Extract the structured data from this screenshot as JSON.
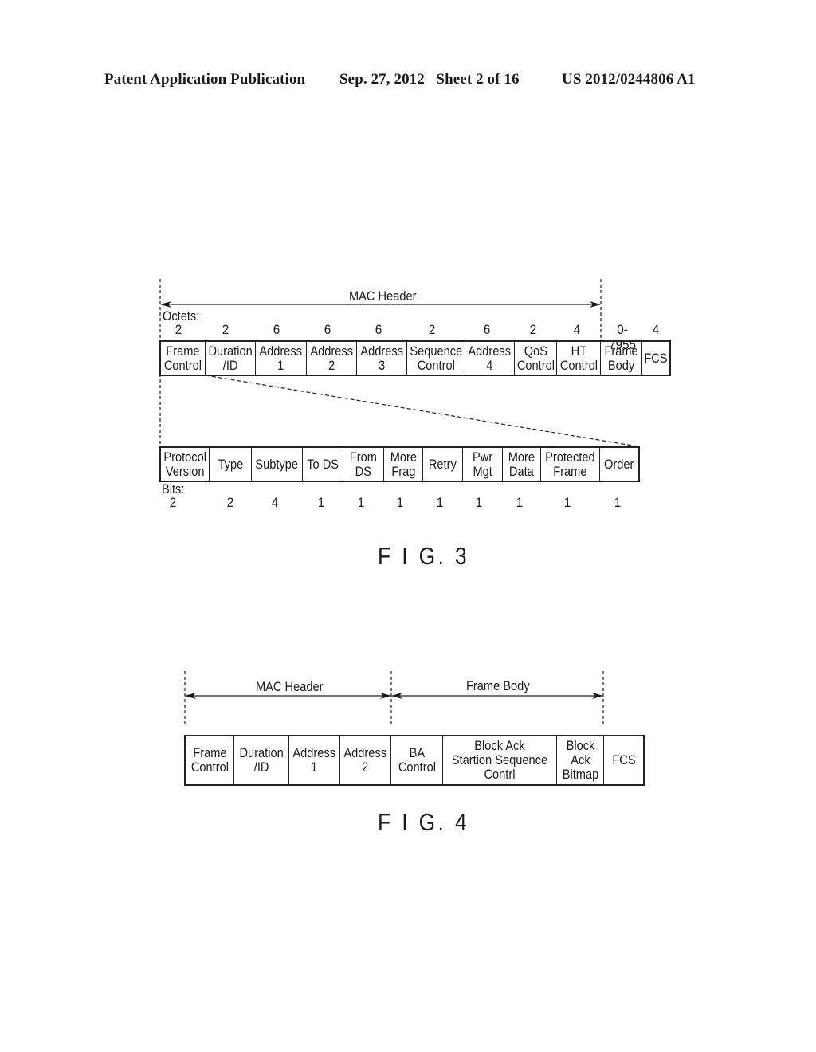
{
  "page_header": {
    "publication": "Patent Application Publication",
    "date_sheet": "Sep. 27, 2012   Sheet 2 of 16",
    "number": "US 2012/0244806 A1"
  },
  "fig3": {
    "caption": "F I G. 3",
    "mac_header_label": "MAC  Header",
    "octets_label": "Octets:",
    "frame_fields": [
      {
        "label": "Frame\nControl",
        "octets": "2"
      },
      {
        "label": "Duration\n/ID",
        "octets": "2"
      },
      {
        "label": "Address\n1",
        "octets": "6"
      },
      {
        "label": "Address\n2",
        "octets": "6"
      },
      {
        "label": "Address\n3",
        "octets": "6"
      },
      {
        "label": "Sequence\nControl",
        "octets": "2"
      },
      {
        "label": "Address\n4",
        "octets": "6"
      },
      {
        "label": "QoS\nControl",
        "octets": "2"
      },
      {
        "label": "HT\nControl",
        "octets": "4"
      },
      {
        "label": "Frame\nBody",
        "octets": "0-7955"
      },
      {
        "label": "FCS",
        "octets": "4"
      }
    ],
    "bits_label": "Bits:",
    "frame_control_fields": [
      {
        "label": "Protocol\nVersion",
        "bits": "2"
      },
      {
        "label": "Type",
        "bits": "2"
      },
      {
        "label": "Subtype",
        "bits": "4"
      },
      {
        "label": "To DS",
        "bits": "1"
      },
      {
        "label": "From\nDS",
        "bits": "1"
      },
      {
        "label": "More\nFrag",
        "bits": "1"
      },
      {
        "label": "Retry",
        "bits": "1"
      },
      {
        "label": "Pwr\nMgt",
        "bits": "1"
      },
      {
        "label": "More\nData",
        "bits": "1"
      },
      {
        "label": "Protected\nFrame",
        "bits": "1"
      },
      {
        "label": "Order",
        "bits": "1"
      }
    ]
  },
  "fig4": {
    "caption": "F I G. 4",
    "mac_header_label": "MAC  Header",
    "frame_body_label": "Frame  Body",
    "fields": [
      {
        "label": "Frame\nControl"
      },
      {
        "label": "Duration\n/ID"
      },
      {
        "label": "Address\n1"
      },
      {
        "label": "Address\n2"
      },
      {
        "label": "BA\nControl"
      },
      {
        "label": "Block  Ack\nStartion  Sequence\nContrl"
      },
      {
        "label": "Block\nAck\nBitmap"
      },
      {
        "label": "FCS"
      }
    ]
  }
}
